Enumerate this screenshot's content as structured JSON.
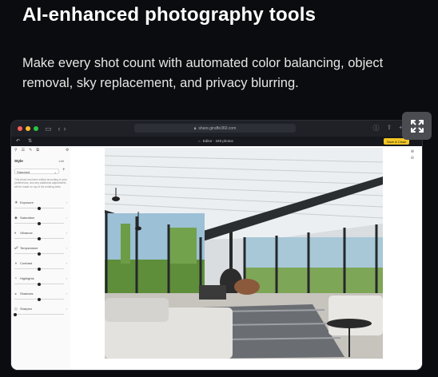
{
  "headline": "AI-enhanced photography tools",
  "subtitle": "Make every shot count with automated color balancing, object removal, sky replacement, and privacy blurring.",
  "browser": {
    "url": "share.giraffe360.com",
    "lock_icon": "lock-icon"
  },
  "app": {
    "title": "Editor · 349 photos",
    "save_button": "Save & Close",
    "sidebar": {
      "section_title": "Style",
      "section_link": "edit",
      "preset": "Standard",
      "description": "This photo has been edited according to your preferences, and any additional adjustments will be made on top of the existing edits.",
      "adjustments": [
        {
          "label": "Exposure",
          "icon": "sun-icon",
          "value": 0.5
        },
        {
          "label": "Saturation",
          "icon": "droplet-icon",
          "value": 0.5
        },
        {
          "label": "Vibrance",
          "icon": "palette-icon",
          "value": 0.5
        },
        {
          "label": "Temperature",
          "icon": "thermometer-icon",
          "value": 0.5
        },
        {
          "label": "Contrast",
          "icon": "contrast-icon",
          "value": 0.5
        },
        {
          "label": "Highlights",
          "icon": "highlight-icon",
          "value": 0.5
        },
        {
          "label": "Shadows",
          "icon": "shadow-icon",
          "value": 0.5
        },
        {
          "label": "Sharpen",
          "icon": "sharpen-icon",
          "value": 0.02
        }
      ]
    }
  },
  "colors": {
    "background": "#0b0c0f",
    "save_button": "#f3c623",
    "expand_button": "#4b4c52"
  }
}
